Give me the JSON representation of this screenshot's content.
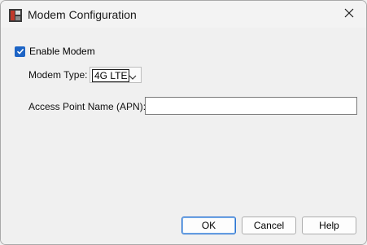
{
  "window": {
    "title": "Modem Configuration"
  },
  "form": {
    "enable_modem_label": "Enable Modem",
    "enable_modem_checked": true,
    "modem_type_label": "Modem Type:",
    "modem_type_value": "4G LTE",
    "apn_label": "Access Point Name (APN):",
    "apn_value": ""
  },
  "buttons": {
    "ok": "OK",
    "cancel": "Cancel",
    "help": "Help"
  },
  "colors": {
    "accent": "#1d64c5",
    "background": "#f0f0f0"
  },
  "icons": {
    "app": "app-logo-icon",
    "close": "close-icon",
    "check": "check-icon",
    "dropdown": "chevron-down-icon"
  }
}
